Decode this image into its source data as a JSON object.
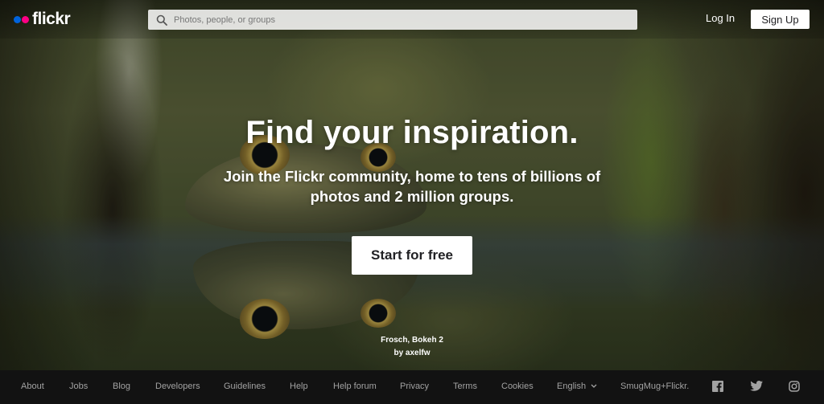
{
  "header": {
    "logo_text": "flickr",
    "search_placeholder": "Photos, people, or groups",
    "login_label": "Log In",
    "signup_label": "Sign Up"
  },
  "hero": {
    "headline": "Find your inspiration.",
    "subline": "Join the Flickr community, home to tens of billions of photos and 2 million groups.",
    "cta_label": "Start for free",
    "photo_title": "Frosch, Bokeh 2",
    "photo_author": "by axelfw"
  },
  "footer": {
    "links": [
      "About",
      "Jobs",
      "Blog",
      "Developers",
      "Guidelines",
      "Help",
      "Help forum",
      "Privacy",
      "Terms",
      "Cookies",
      "English",
      "SmugMug+Flickr."
    ],
    "social_icons": [
      "facebook-icon",
      "twitter-icon",
      "instagram-icon"
    ]
  },
  "colors": {
    "logo_blue": "#0063dc",
    "logo_pink": "#ff0084",
    "footer_bg": "#121212",
    "footer_link": "#a2a2a2"
  }
}
